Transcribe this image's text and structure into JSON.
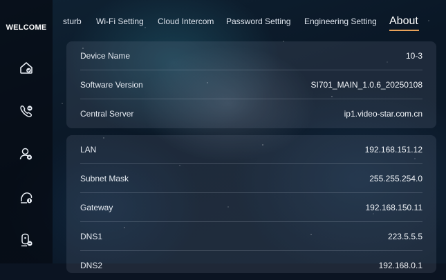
{
  "sidebar": {
    "title": "WELCOME",
    "items": [
      {
        "icon": "home-icon"
      },
      {
        "icon": "phone-icon"
      },
      {
        "icon": "user-settings-icon"
      },
      {
        "icon": "user-info-icon"
      },
      {
        "icon": "device-icon"
      }
    ]
  },
  "tabs": [
    {
      "label": "sturb",
      "active": false
    },
    {
      "label": "Wi-Fi Setting",
      "active": false
    },
    {
      "label": "Cloud Intercom",
      "active": false
    },
    {
      "label": "Password Setting",
      "active": false
    },
    {
      "label": "Engineering Setting",
      "active": false
    },
    {
      "label": "About",
      "active": true
    }
  ],
  "accent_color": "#e8a25a",
  "device_card": {
    "rows": [
      {
        "label": "Device Name",
        "value": "10-3"
      },
      {
        "label": "Software Version",
        "value": "SI701_MAIN_1.0.6_20250108"
      },
      {
        "label": "Central Server",
        "value": "ip1.video-star.com.cn"
      }
    ]
  },
  "network_card": {
    "rows": [
      {
        "label": "LAN",
        "value": "192.168.151.12"
      },
      {
        "label": "Subnet Mask",
        "value": "255.255.254.0"
      },
      {
        "label": "Gateway",
        "value": "192.168.150.11"
      },
      {
        "label": "DNS1",
        "value": "223.5.5.5"
      },
      {
        "label": "DNS2",
        "value": "192.168.0.1"
      }
    ]
  }
}
